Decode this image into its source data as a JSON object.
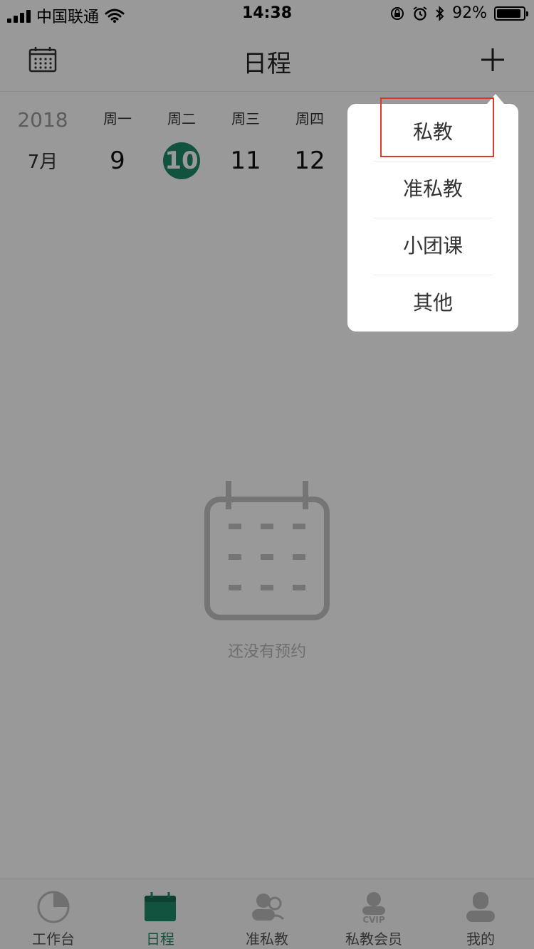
{
  "status_bar": {
    "carrier": "中国联通",
    "time": "14:38",
    "battery_percent": "92%",
    "battery_level": 0.92,
    "icons": [
      "signal-icon",
      "wifi-icon",
      "orientation-lock-icon",
      "alarm-icon",
      "bluetooth-icon",
      "battery-icon"
    ]
  },
  "nav": {
    "title": "日程",
    "left_icon": "calendar-icon",
    "right_icon": "plus-icon"
  },
  "week": {
    "year": "2018",
    "month": "7月",
    "days": [
      {
        "weekday": "周一",
        "day": "9",
        "selected": false
      },
      {
        "weekday": "周二",
        "day": "10",
        "selected": true
      },
      {
        "weekday": "周三",
        "day": "11",
        "selected": false
      },
      {
        "weekday": "周四",
        "day": "12",
        "selected": false
      }
    ]
  },
  "empty_state": {
    "icon": "empty-calendar-icon",
    "text": "还没有预约"
  },
  "popup_menu": {
    "items": [
      "私教",
      "准私教",
      "小团课",
      "其他"
    ],
    "highlighted_index": 0
  },
  "tab_bar": {
    "items": [
      {
        "label": "工作台",
        "icon": "pie-chart-icon",
        "active": false
      },
      {
        "label": "日程",
        "icon": "calendar-icon",
        "active": true
      },
      {
        "label": "准私教",
        "icon": "semi-private-icon",
        "active": false
      },
      {
        "label": "私教会员",
        "icon": "vip-member-icon",
        "active": false
      },
      {
        "label": "我的",
        "icon": "profile-icon",
        "active": false
      }
    ]
  },
  "colors": {
    "accent": "#1f8a6a",
    "highlight_border": "#d93a2b"
  }
}
